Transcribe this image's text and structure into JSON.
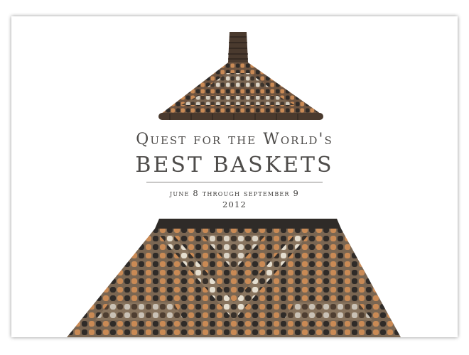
{
  "exhibit": {
    "title_line1": "Quest for the World's",
    "title_line2": "BEST BASKETS",
    "dates": "june 8 through september 9",
    "year": "2012"
  },
  "images": {
    "lid": "basket-lid-icon",
    "base": "basket-base-icon"
  },
  "colors": {
    "text": "#4e4c4a",
    "basket_dark": "#2f2b28",
    "basket_brown": "#6e5440",
    "basket_orange": "#c98a55",
    "basket_cream": "#efe7d8"
  }
}
